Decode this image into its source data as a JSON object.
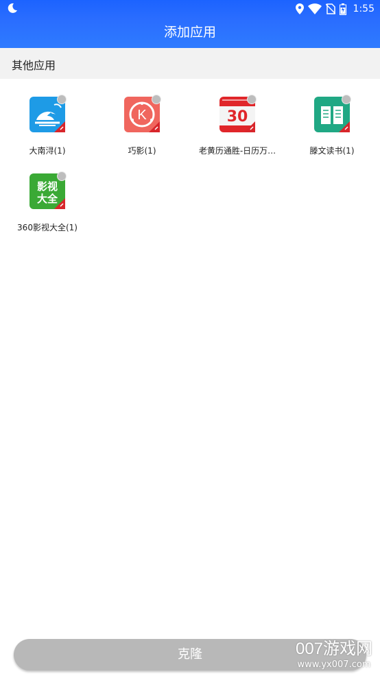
{
  "status_bar": {
    "time": "1:55",
    "icons": [
      "moon-icon",
      "location-icon",
      "wifi-icon",
      "no-sim-icon",
      "battery-icon"
    ]
  },
  "header": {
    "title": "添加应用"
  },
  "section": {
    "title": "其他应用"
  },
  "apps": [
    {
      "label": "大南浔(1)",
      "icon": "da-nan-xun-icon",
      "color": "#1e9be6"
    },
    {
      "label": "巧影(1)",
      "icon": "kinemaster-icon",
      "color": "#f0665e"
    },
    {
      "label": "老黄历通胜-日历万…",
      "icon": "calendar-icon",
      "color": "#e0262a",
      "icon_text": "30"
    },
    {
      "label": "滕文读书(1)",
      "icon": "book-icon",
      "color": "#20a884"
    },
    {
      "label": "360影视大全(1)",
      "icon": "video-app-icon",
      "color": "#3aa935",
      "icon_text": "影视大全"
    }
  ],
  "clone_button": {
    "label": "克隆"
  },
  "watermark": {
    "big": "007游戏网",
    "small": "www.yx007.com"
  },
  "colors": {
    "header_blue": "#2a6dff",
    "button_gray": "#b8b8b8"
  }
}
